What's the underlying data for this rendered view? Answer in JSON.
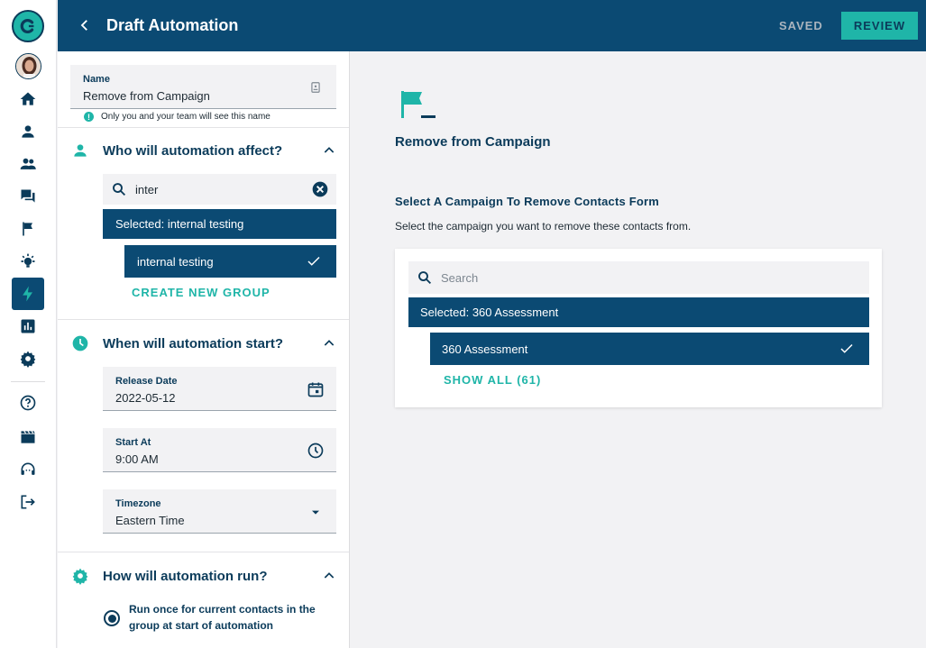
{
  "header": {
    "title": "Draft Automation",
    "status": "SAVED",
    "review_label": "REVIEW"
  },
  "name_field": {
    "label": "Name",
    "value": "Remove from Campaign",
    "hint": "Only you and your team will see this name"
  },
  "affect_section": {
    "title": "Who will automation affect?",
    "search_value": "inter",
    "selected_label": "Selected: internal testing",
    "options": [
      {
        "label": "internal testing",
        "checked": true
      }
    ],
    "create_label": "CREATE NEW GROUP"
  },
  "start_section": {
    "title": "When will automation start?",
    "release_date": {
      "label": "Release Date",
      "value": "2022-05-12"
    },
    "start_at": {
      "label": "Start At",
      "value": "9:00 AM"
    },
    "timezone": {
      "label": "Timezone",
      "value": "Eastern Time"
    }
  },
  "run_section": {
    "title": "How will automation run?",
    "radio_label": "Run once for current contacts in the group at start of automation"
  },
  "main": {
    "title": "Remove from Campaign",
    "form_title": "Select A Campaign To Remove Contacts Form",
    "form_desc": "Select the campaign you want to remove these contacts from.",
    "search_placeholder": "Search",
    "selected_label": "Selected: 360 Assessment",
    "options": [
      {
        "label": "360 Assessment",
        "checked": true
      }
    ],
    "show_all_label": "SHOW ALL (61)"
  },
  "rail": {
    "items": [
      "home-icon",
      "person-icon",
      "people-icon",
      "chat-icon",
      "flag-icon",
      "lightbulb-icon",
      "lightning-icon",
      "chart-icon",
      "gear-icon",
      "help-icon",
      "film-icon",
      "headset-icon",
      "logout-icon"
    ],
    "active": "lightning-icon"
  },
  "colors": {
    "navy": "#0b4a73",
    "teal": "#1fb5a8",
    "background": "#f2f2f4"
  }
}
